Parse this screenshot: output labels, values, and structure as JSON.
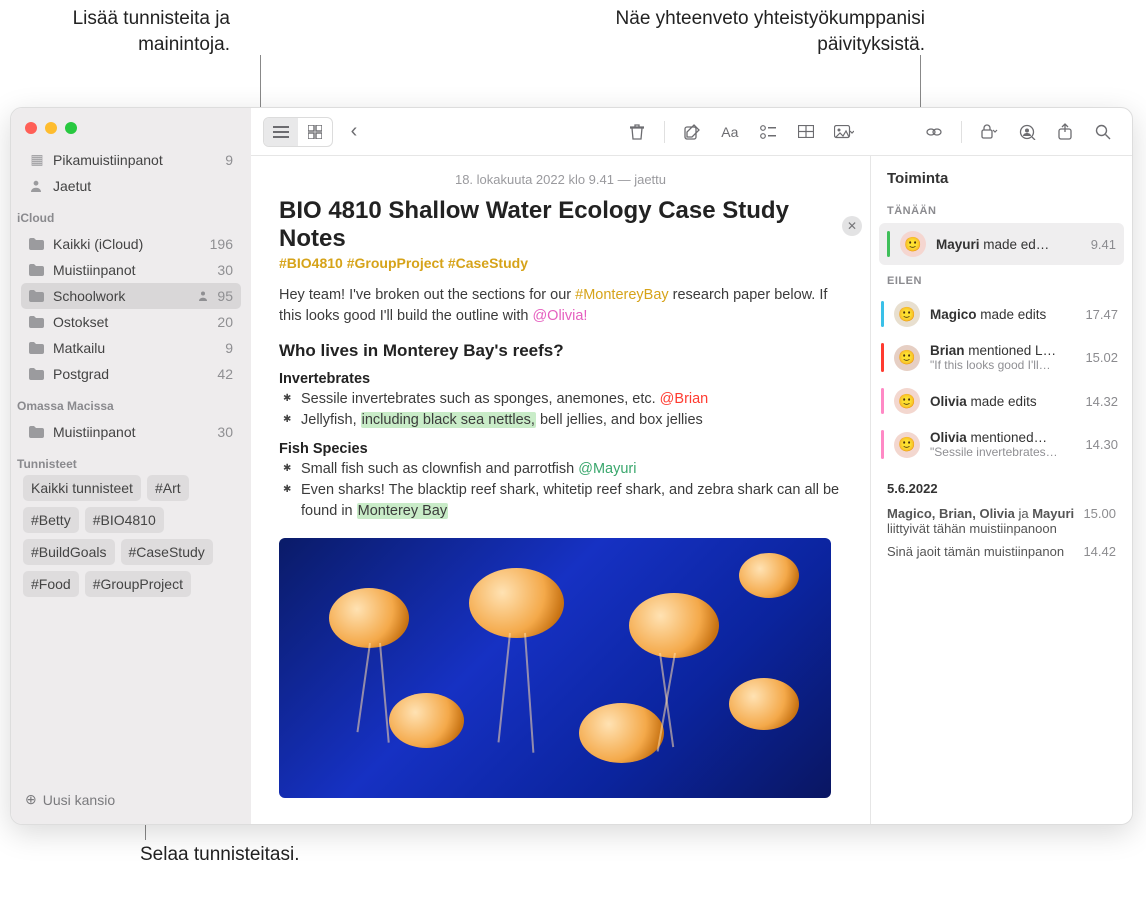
{
  "callouts": {
    "top_left": "Lisää tunnisteita ja\nmainintoja.",
    "top_right": "Näe yhteenveto yhteistyökumppanisi\npäivityksistä.",
    "bottom": "Selaa tunnisteitasi."
  },
  "sidebar": {
    "top_items": [
      {
        "icon": "⊞",
        "label": "Pikamuistiinpanot",
        "count": "9"
      },
      {
        "icon": "👤",
        "label": "Jaetut",
        "count": ""
      }
    ],
    "groups": [
      {
        "header": "iCloud",
        "items": [
          {
            "label": "Kaikki (iCloud)",
            "count": "196",
            "shared": false,
            "selected": false
          },
          {
            "label": "Muistiinpanot",
            "count": "30",
            "shared": false,
            "selected": false
          },
          {
            "label": "Schoolwork",
            "count": "95",
            "shared": true,
            "selected": true
          },
          {
            "label": "Ostokset",
            "count": "20",
            "shared": false,
            "selected": false
          },
          {
            "label": "Matkailu",
            "count": "9",
            "shared": false,
            "selected": false
          },
          {
            "label": "Postgrad",
            "count": "42",
            "shared": false,
            "selected": false
          }
        ]
      },
      {
        "header": "Omassa Macissa",
        "items": [
          {
            "label": "Muistiinpanot",
            "count": "30",
            "shared": false,
            "selected": false
          }
        ]
      }
    ],
    "tags_header": "Tunnisteet",
    "tags": [
      "Kaikki tunnisteet",
      "#Art",
      "#Betty",
      "#BIO4810",
      "#BuildGoals",
      "#CaseStudy",
      "#Food",
      "#GroupProject"
    ],
    "new_folder": "Uusi kansio"
  },
  "note": {
    "date": "18. lokakuuta 2022 klo 9.41 — jaettu",
    "title": "BIO 4810 Shallow Water Ecology Case Study Notes",
    "hashtags": "#BIO4810 #GroupProject #CaseStudy",
    "intro_a": "Hey team! I've broken out the sections for our ",
    "intro_hash": "#MontereyBay",
    "intro_b": " research paper below. If this looks good I'll build the outline with ",
    "intro_mention": "@Olivia!",
    "h2": "Who lives in Monterey Bay's reefs?",
    "s1_h": "Invertebrates",
    "s1_l1a": "Sessile invertebrates such as sponges, anemones, etc. ",
    "s1_l1m": "@Brian",
    "s1_l2a": "Jellyfish, ",
    "s1_l2hl": "including black sea nettles,",
    "s1_l2b": " bell jellies, and box jellies",
    "s2_h": "Fish Species",
    "s2_l1a": "Small fish such as clownfish and parrotfish ",
    "s2_l1m": "@Mayuri",
    "s2_l2a": "Even sharks! The blacktip reef shark, whitetip reef shark, and zebra shark can all be found in ",
    "s2_l2hl": "Monterey Bay"
  },
  "activity": {
    "title": "Toiminta",
    "sections": [
      {
        "header": "TÄNÄÄN",
        "items": [
          {
            "color": "#3fbf5a",
            "avatar_bg": "#f5d6d0",
            "name": "Mayuri",
            "text": " made ed…",
            "sub": "",
            "time": "9.41",
            "selected": true
          }
        ]
      },
      {
        "header": "EILEN",
        "items": [
          {
            "color": "#3ac0e8",
            "avatar_bg": "#e8dfcf",
            "name": "Magico",
            "text": " made edits",
            "sub": "",
            "time": "17.47",
            "selected": false
          },
          {
            "color": "#ff3b30",
            "avatar_bg": "#e6cfc4",
            "name": "Brian",
            "text": " mentioned L…",
            "sub": "\"If this looks good I'll…",
            "time": "15.02",
            "selected": false
          },
          {
            "color": "#ff89c5",
            "avatar_bg": "#f3d7cf",
            "name": "Olivia",
            "text": " made edits",
            "sub": "",
            "time": "14.32",
            "selected": false
          },
          {
            "color": "#ff89c5",
            "avatar_bg": "#f3d7cf",
            "name": "Olivia",
            "text": " mentioned…",
            "sub": "\"Sessile invertebrates…",
            "time": "14.30",
            "selected": false
          }
        ]
      }
    ],
    "date_header": "5.6.2022",
    "plain": [
      {
        "text_a": "Magico, Brian, Olivia",
        "text_mid": " ja ",
        "text_b": "Mayuri",
        "text_c": " liittyivät tähän muistiinpanoon",
        "time": "15.00"
      },
      {
        "text": "Sinä jaoit tämän muistiinpanon",
        "time": "14.42"
      }
    ]
  },
  "toolbar_icons": {
    "list": "list-icon",
    "grid": "grid-icon",
    "back": "back-icon",
    "trash": "trash-icon",
    "compose": "compose-icon",
    "format": "format-icon",
    "checklist": "checklist-icon",
    "table": "table-icon",
    "media": "media-icon",
    "link": "link-icon",
    "lock": "lock-icon",
    "collab": "collab-icon",
    "share": "share-icon",
    "search": "search-icon"
  }
}
